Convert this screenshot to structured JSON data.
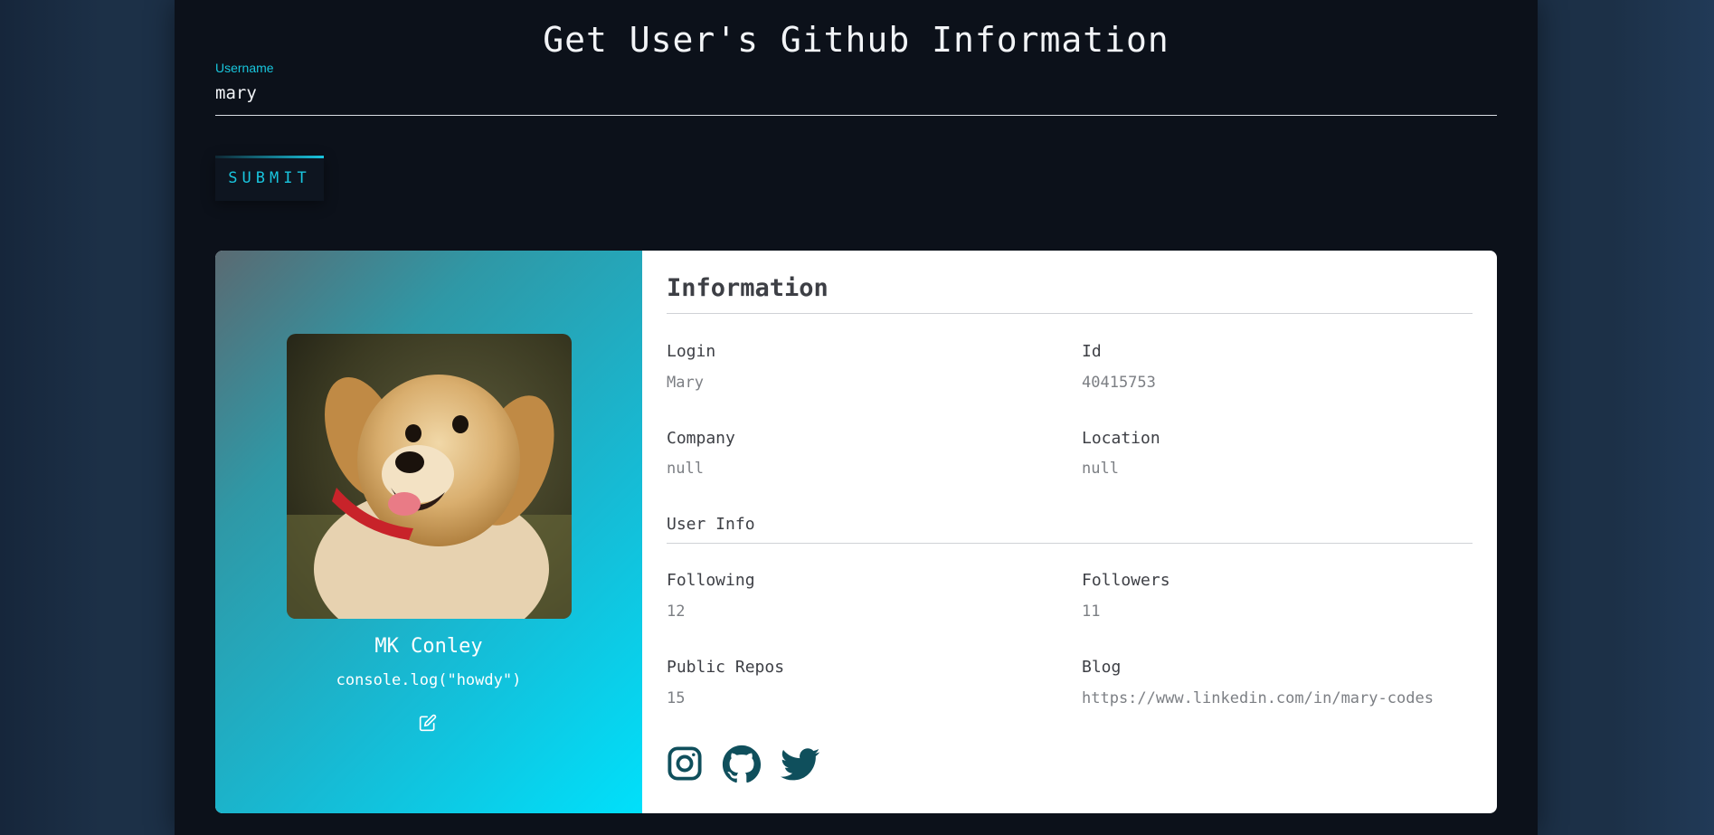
{
  "header": {
    "title": "Get User's Github Information"
  },
  "search": {
    "label": "Username",
    "value": "mary"
  },
  "submit": {
    "label": "SUBMIT"
  },
  "profile": {
    "name": "MK Conley",
    "bio": "console.log(\"howdy\")",
    "avatar_icon": "puppy-photo",
    "edit_icon": "edit-icon"
  },
  "info": {
    "heading": "Information",
    "login_label": "Login",
    "login_value": "Mary",
    "id_label": "Id",
    "id_value": "40415753",
    "company_label": "Company",
    "company_value": "null",
    "location_label": "Location",
    "location_value": "null",
    "user_info_heading": "User Info",
    "following_label": "Following",
    "following_value": "12",
    "followers_label": "Followers",
    "followers_value": "11",
    "repos_label": "Public Repos",
    "repos_value": "15",
    "blog_label": "Blog",
    "blog_value": "https://www.linkedin.com/in/mary-codes"
  },
  "social": {
    "icons": [
      "instagram-icon",
      "github-icon",
      "twitter-icon"
    ],
    "color": "#0f4f5c"
  },
  "colors": {
    "accent": "#19c5de",
    "background": "#0c111a",
    "text_dark": "#3d3f45",
    "text_muted": "#7c7f84"
  }
}
